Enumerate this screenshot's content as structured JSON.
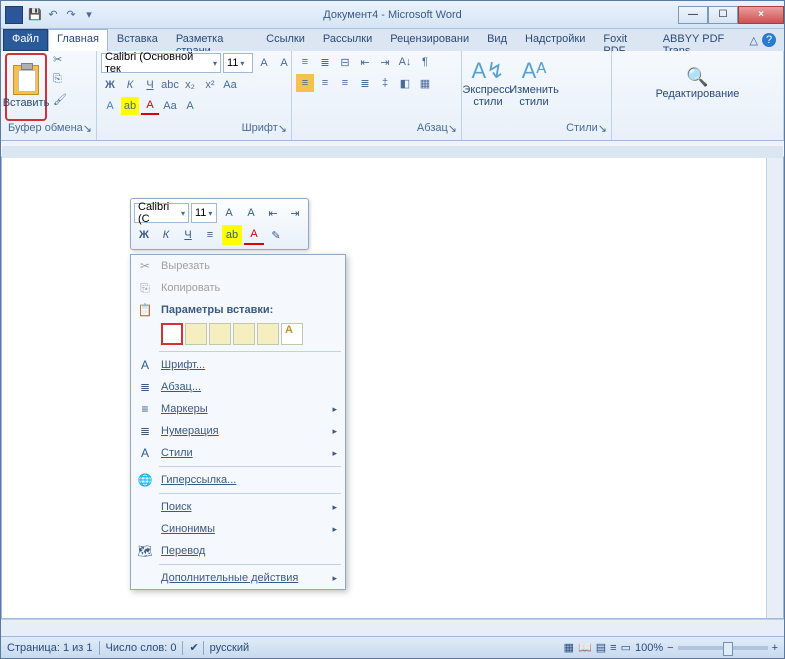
{
  "title": "Документ4 - Microsoft Word",
  "qa": [
    "save",
    "undo",
    "redo",
    "meta"
  ],
  "tabs": {
    "file": "Файл",
    "list": [
      "Главная",
      "Вставка",
      "Разметка страни",
      "Ссылки",
      "Рассылки",
      "Рецензировани",
      "Вид",
      "Надстройки",
      "Foxit PDF",
      "ABBYY PDF Trans"
    ]
  },
  "clipboard": {
    "paste": "Вставить",
    "group": "Буфер обмена"
  },
  "font": {
    "name": "Calibri (Основной тек",
    "size": "11",
    "group": "Шрифт"
  },
  "paragraph": {
    "group": "Абзац"
  },
  "styles": {
    "express": "Экспресс-стили",
    "change": "Изменить\nстили",
    "group": "Стили"
  },
  "editing": {
    "label": "Редактирование"
  },
  "minitb": {
    "font": "Calibri (С",
    "size": "11"
  },
  "ctx": {
    "cut": "Вырезать",
    "copy": "Копировать",
    "pasteopts": "Параметры вставки:",
    "font": "Шрифт...",
    "para": "Абзац...",
    "bullets": "Маркеры",
    "numbering": "Нумерация",
    "styles": "Стили",
    "hyperlink": "Гиперссылка...",
    "search": "Поиск",
    "synonyms": "Синонимы",
    "translate": "Перевод",
    "extra": "Дополнительные действия"
  },
  "status": {
    "page": "Страница: 1 из 1",
    "words": "Число слов: 0",
    "lang": "русский",
    "zoom": "100%"
  }
}
